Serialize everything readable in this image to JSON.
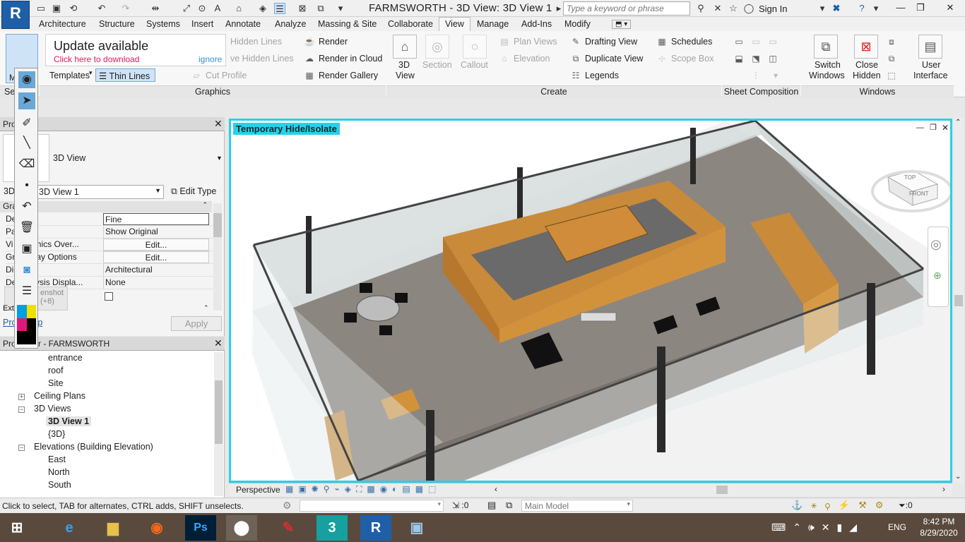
{
  "app": {
    "logo": "R",
    "title": "FARMSWORTH - 3D View: 3D View 1",
    "search_placeholder": "Type a keyword or phrase",
    "signin": "Sign In"
  },
  "tabs": [
    "Architecture",
    "Structure",
    "Systems",
    "Insert",
    "Annotate",
    "Analyze",
    "Massing & Site",
    "Collaborate",
    "View",
    "Manage",
    "Add-Ins",
    "Modify"
  ],
  "active_tab": "View",
  "ribbon": {
    "modify_label": "Modify",
    "select_label": "Se",
    "update": {
      "title": "Update available",
      "link": "Click here to download",
      "ignore": "ignore"
    },
    "graphics": {
      "hidden_lines_1": "Hidden Lines",
      "hidden_lines_2": "ve Hidden Lines",
      "templates": "Templates",
      "thin_lines": "Thin Lines",
      "cut_profile": "Cut Profile",
      "render": "Render",
      "render_cloud": "Render in Cloud",
      "render_gallery": "Render Gallery",
      "panel": "Graphics"
    },
    "create": {
      "view3d": "3D",
      "view3d_2": "View",
      "section": "Section",
      "callout": "Callout",
      "plan_views": "Plan Views",
      "elevation": "Elevation",
      "drafting": "Drafting View",
      "duplicate": "Duplicate View",
      "legends": "Legends",
      "schedules": "Schedules",
      "scope_box": "Scope Box",
      "panel": "Create"
    },
    "sheet_panel": "Sheet Composition",
    "windows": {
      "switch": "Switch",
      "switch_2": "Windows",
      "close": "Close",
      "close_2": "Hidden",
      "ui": "User",
      "ui_2": "Interface",
      "panel": "Windows"
    }
  },
  "properties": {
    "title": "Pro",
    "type_name": "3D View",
    "instance_prefix": "3D",
    "instance": "3D View 1",
    "edit_type": "Edit Type",
    "group": "Gra",
    "rows": [
      {
        "name": "De   evel",
        "value": "Fine"
      },
      {
        "name": "Pa   ibility",
        "value": "Show Original"
      },
      {
        "name": "Vi   /Graphics Over...",
        "value": "Edit..."
      },
      {
        "name": "Gr   Display Options",
        "value": "Edit..."
      },
      {
        "name": "Di   e",
        "value": "Architectural"
      },
      {
        "name": "De   Analysis Displa...",
        "value": "None"
      }
    ],
    "screenshot_hint": "enshot",
    "screenshot_hint_2": "(+8)",
    "ext": "Ext",
    "help": "Pro    s help",
    "apply": "Apply"
  },
  "browser": {
    "title": "Pro    owser - FARMSWORTH",
    "items": [
      {
        "label": "entrance",
        "level": 2
      },
      {
        "label": "roof",
        "level": 2
      },
      {
        "label": "Site",
        "level": 2
      },
      {
        "label": "Ceiling Plans",
        "level": 1,
        "toggle": "+"
      },
      {
        "label": "3D Views",
        "level": 1,
        "toggle": "−"
      },
      {
        "label": "3D View 1",
        "level": 2,
        "selected": true
      },
      {
        "label": "{3D}",
        "level": 2
      },
      {
        "label": "Elevations (Building Elevation)",
        "level": 1,
        "toggle": "−"
      },
      {
        "label": "East",
        "level": 2
      },
      {
        "label": "North",
        "level": 2
      },
      {
        "label": "South",
        "level": 2
      }
    ]
  },
  "viewport": {
    "label": "Temporary Hide/Isolate",
    "cube_top": "TOP",
    "cube_front": "FRONT",
    "view_style": "Perspective"
  },
  "status": {
    "message": "Click to select, TAB for alternates, CTRL adds, SHIFT unselects.",
    "count": ":0",
    "model": "Main Model",
    "filter": ":0"
  },
  "taskbar": {
    "lang": "ENG",
    "time": "8:42 PM",
    "date": "8/29/2020",
    "apps": [
      "ie-icon",
      "explorer-icon",
      "firefox-icon",
      "photoshop-icon",
      "pen-icon",
      "whiteboard-icon",
      "3dsmax-icon",
      "revit-icon",
      "photos-icon"
    ],
    "app_labels": {
      "ps": "Ps",
      "max": "3",
      "revit": "R"
    }
  },
  "colors": {
    "accent": "#28d0ea",
    "taskbar": "#5a4a3e",
    "revit_blue": "#1f5fa8"
  }
}
